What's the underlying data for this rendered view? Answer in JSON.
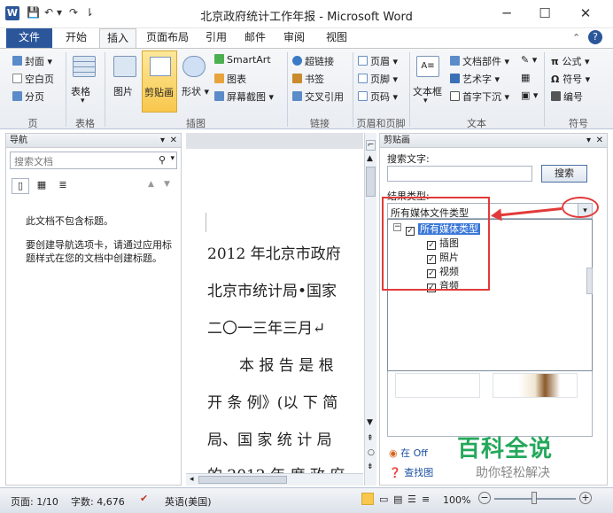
{
  "window": {
    "title": "北京政府统计工作年报 - Microsoft Word",
    "app_icon": "W",
    "qat": [
      "save-icon",
      "undo-icon",
      "redo-icon",
      "customize-icon"
    ],
    "controls": [
      "─",
      "☐",
      "✕"
    ]
  },
  "tabs": [
    "文件",
    "开始",
    "插入",
    "页面布局",
    "引用",
    "邮件",
    "审阅",
    "视图"
  ],
  "active_tab": "插入",
  "ribbon": {
    "pages": {
      "items": [
        "封面",
        "空白页",
        "分页"
      ],
      "label": "页"
    },
    "table": {
      "button": "表格",
      "label": "表格"
    },
    "illustrations": {
      "buttons": [
        "图片",
        "剪贴画",
        "形状"
      ],
      "small": [
        "SmartArt",
        "图表",
        "屏幕截图"
      ],
      "label": "插图"
    },
    "links": {
      "items": [
        "超链接",
        "书签",
        "交叉引用"
      ],
      "label": "链接"
    },
    "header_footer": {
      "items": [
        "页眉",
        "页脚",
        "页码"
      ],
      "label": "页眉和页脚"
    },
    "text": {
      "textbox": "文本框",
      "items": [
        "文档部件",
        "艺术字",
        "首字下沉"
      ],
      "label": "文本"
    },
    "symbols": {
      "items": [
        "公式",
        "符号",
        "编号"
      ],
      "label": "符号"
    }
  },
  "nav_pane": {
    "title": "导航",
    "search_placeholder": "搜索文档",
    "msg1": "此文档不包含标题。",
    "msg2": "要创建导航选项卡，请通过应用标题样式在您的文档中创建标题。"
  },
  "document": {
    "lines": [
      "2012 年北京市政府",
      "北京市统计局•国家",
      "二〇一三年三月↵",
      "本 报 告 是 根",
      "开 条 例》(以 下 简",
      "局、国 家 统 计 局",
      "的 2012 年 度 政 府"
    ]
  },
  "clip_pane": {
    "title": "剪贴画",
    "search_label": "搜索文字:",
    "search_value": "",
    "search_button": "搜索",
    "result_label": "结果类型:",
    "dropdown_value": "所有媒体文件类型",
    "tree_root": "所有媒体类型",
    "tree_items": [
      "插图",
      "照片",
      "视频",
      "音频"
    ],
    "link1": "在 Off",
    "link2": "查找图"
  },
  "watermark": {
    "line1": "百科全说",
    "line2": "助你轻松解决"
  },
  "status": {
    "page": "页面: 1/10",
    "words": "字数: 4,676",
    "language": "英语(美国)",
    "zoom": "100%",
    "zoom_minus": "−",
    "zoom_plus": "+"
  }
}
